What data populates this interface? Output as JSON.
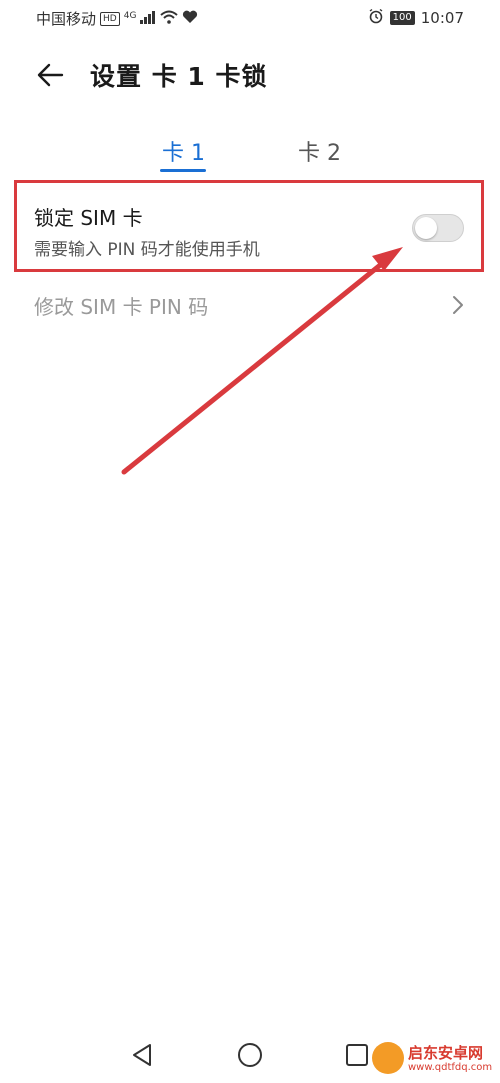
{
  "status_bar": {
    "carrier": "中国移动",
    "hd": "HD",
    "network": "4G",
    "battery": "100",
    "time": "10:07"
  },
  "header": {
    "title": "设置 卡 1 卡锁"
  },
  "tabs": [
    {
      "label": "卡 1",
      "active": true
    },
    {
      "label": "卡 2",
      "active": false
    }
  ],
  "lock_sim": {
    "title": "锁定 SIM 卡",
    "subtitle": "需要输入 PIN 码才能使用手机",
    "enabled": false
  },
  "change_pin": {
    "label": "修改 SIM 卡 PIN 码"
  },
  "watermark": {
    "name": "启东安卓网",
    "url": "www.qdtfdq.com"
  },
  "colors": {
    "accent": "#1a6fd4",
    "annotation": "#d93a3e"
  }
}
